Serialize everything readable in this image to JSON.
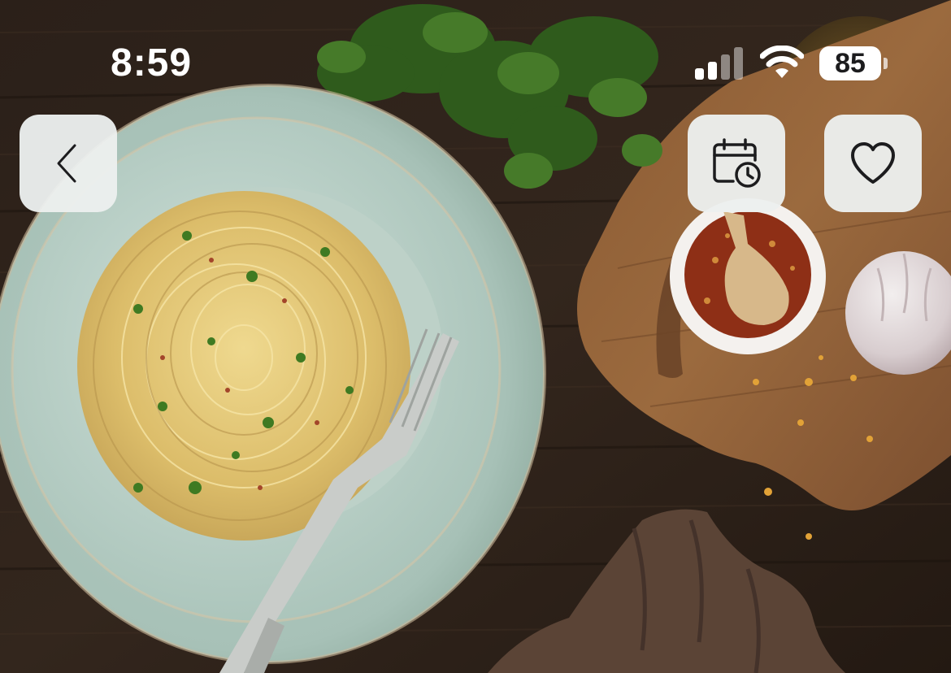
{
  "status_bar": {
    "time": "8:59",
    "signal_bars_active": 2,
    "signal_bars_total": 4,
    "battery_percent": "85",
    "battery_level": 0.85
  },
  "toolbar": {
    "back_icon": "chevron-left-icon",
    "schedule_icon": "calendar-clock-icon",
    "favorite_icon": "heart-outline-icon"
  },
  "hero_image": {
    "subject": "spaghetti-aglio-e-olio-photo"
  },
  "colors": {
    "button_bg": "#eceeed",
    "icon_stroke": "#1c1c1e",
    "status_text": "#ffffff"
  }
}
